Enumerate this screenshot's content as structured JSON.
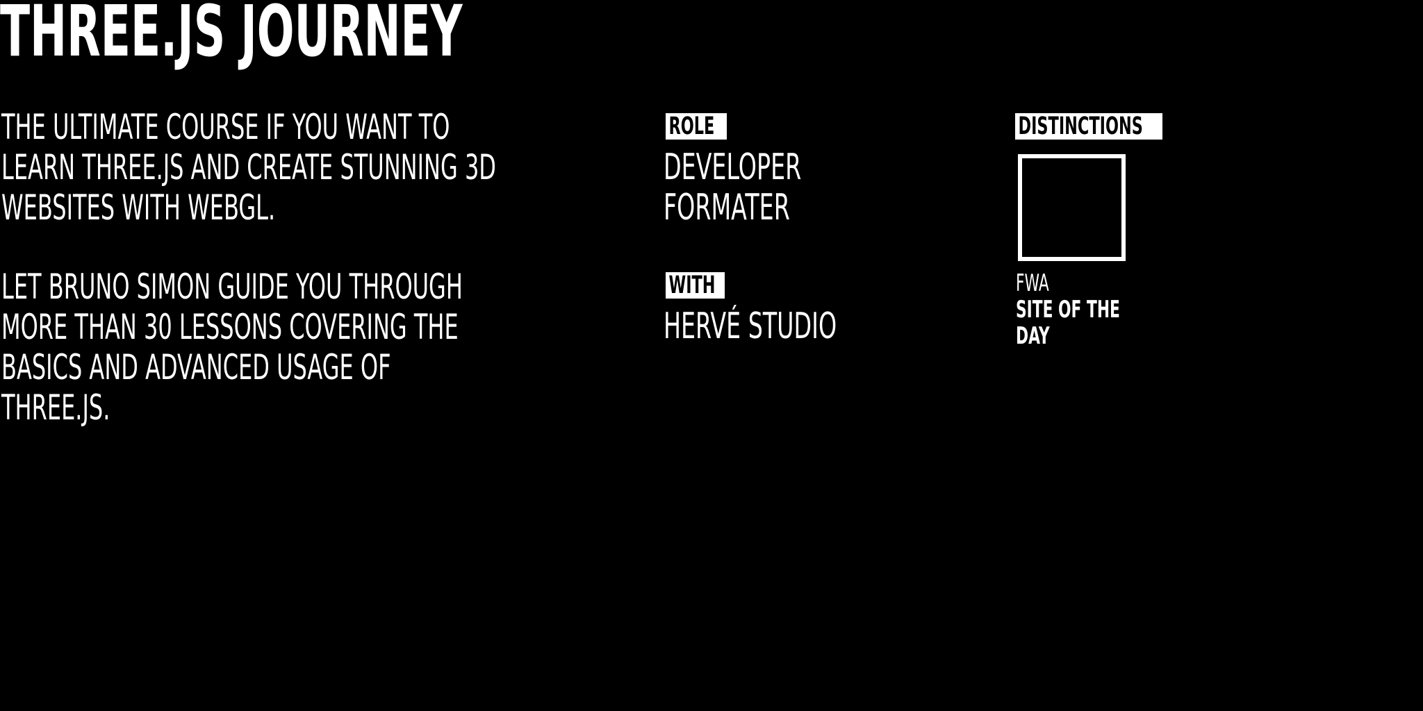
{
  "header": {
    "title": "THREE.JS JOURNEY"
  },
  "description": {
    "paragraph1": [
      "THE ULTIMATE COURSE IF YOU WANT TO",
      "LEARN THREE.JS AND CREATE STUNNING 3D",
      "WEBSITES WITH WEBGL."
    ],
    "paragraph2": [
      "LET BRUNO SIMON GUIDE YOU THROUGH",
      "MORE THAN 30 LESSONS COVERING THE",
      "BASICS AND ADVANCED USAGE OF",
      "THREE.JS."
    ]
  },
  "role": {
    "label": "ROLE",
    "values": [
      "DEVELOPER",
      "FORMATER"
    ]
  },
  "with": {
    "label": "WITH",
    "value": "HERVÉ STUDIO"
  },
  "distinctions": {
    "label": "DISTINCTIONS",
    "awards": [
      {
        "org": "FWA",
        "name_lines": [
          "SITE OF THE",
          "DAY"
        ],
        "icon": "award-badge-icon"
      }
    ]
  },
  "colors": {
    "background": "#000000",
    "foreground": "#ffffff"
  }
}
